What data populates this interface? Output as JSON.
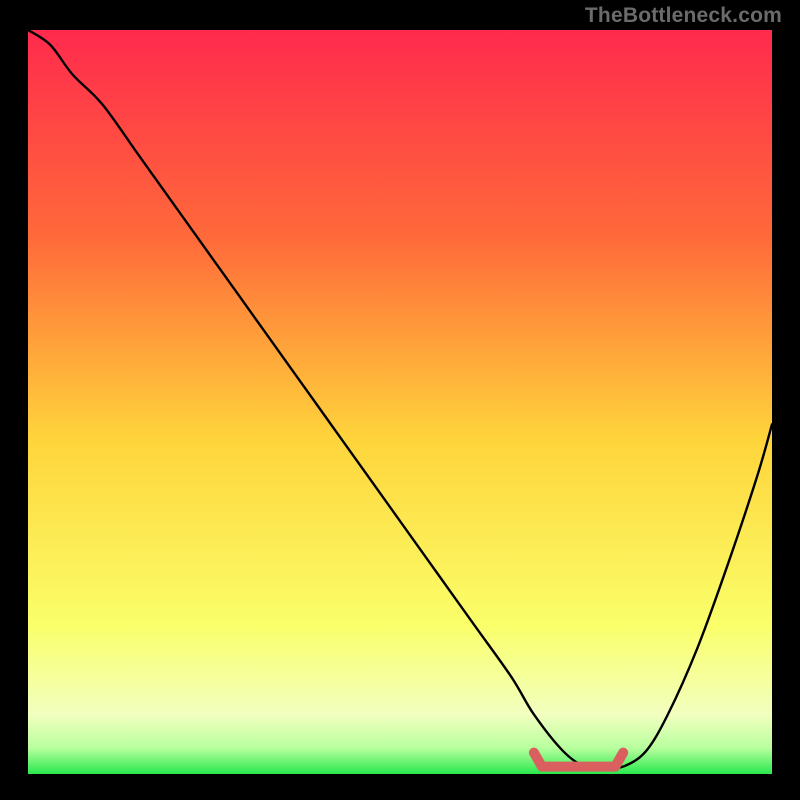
{
  "watermark": "TheBottleneck.com",
  "colors": {
    "bg": "#000000",
    "grad_top": "#ff2a4d",
    "grad_mid_upper": "#ff6f3a",
    "grad_mid": "#ffd43b",
    "grad_low": "#faff70",
    "grad_green": "#29e84d",
    "curve": "#000000",
    "marker": "#d9605f"
  },
  "chart_data": {
    "type": "line",
    "title": "",
    "xlabel": "",
    "ylabel": "",
    "xlim": [
      0,
      100
    ],
    "ylim": [
      0,
      100
    ],
    "series": [
      {
        "name": "bottleneck-curve",
        "x": [
          0,
          3,
          6,
          10,
          15,
          20,
          25,
          30,
          35,
          40,
          45,
          50,
          55,
          60,
          65,
          68,
          72,
          75,
          78,
          80,
          83,
          86,
          90,
          94,
          98,
          100
        ],
        "values": [
          100,
          98,
          94,
          90,
          83,
          76,
          69,
          62,
          55,
          48,
          41,
          34,
          27,
          20,
          13,
          8,
          3,
          1,
          1,
          1,
          3,
          8,
          17,
          28,
          40,
          47
        ]
      }
    ],
    "annotations": [
      {
        "name": "optimal-range",
        "x_start": 68,
        "x_end": 80,
        "y": 1
      }
    ]
  }
}
